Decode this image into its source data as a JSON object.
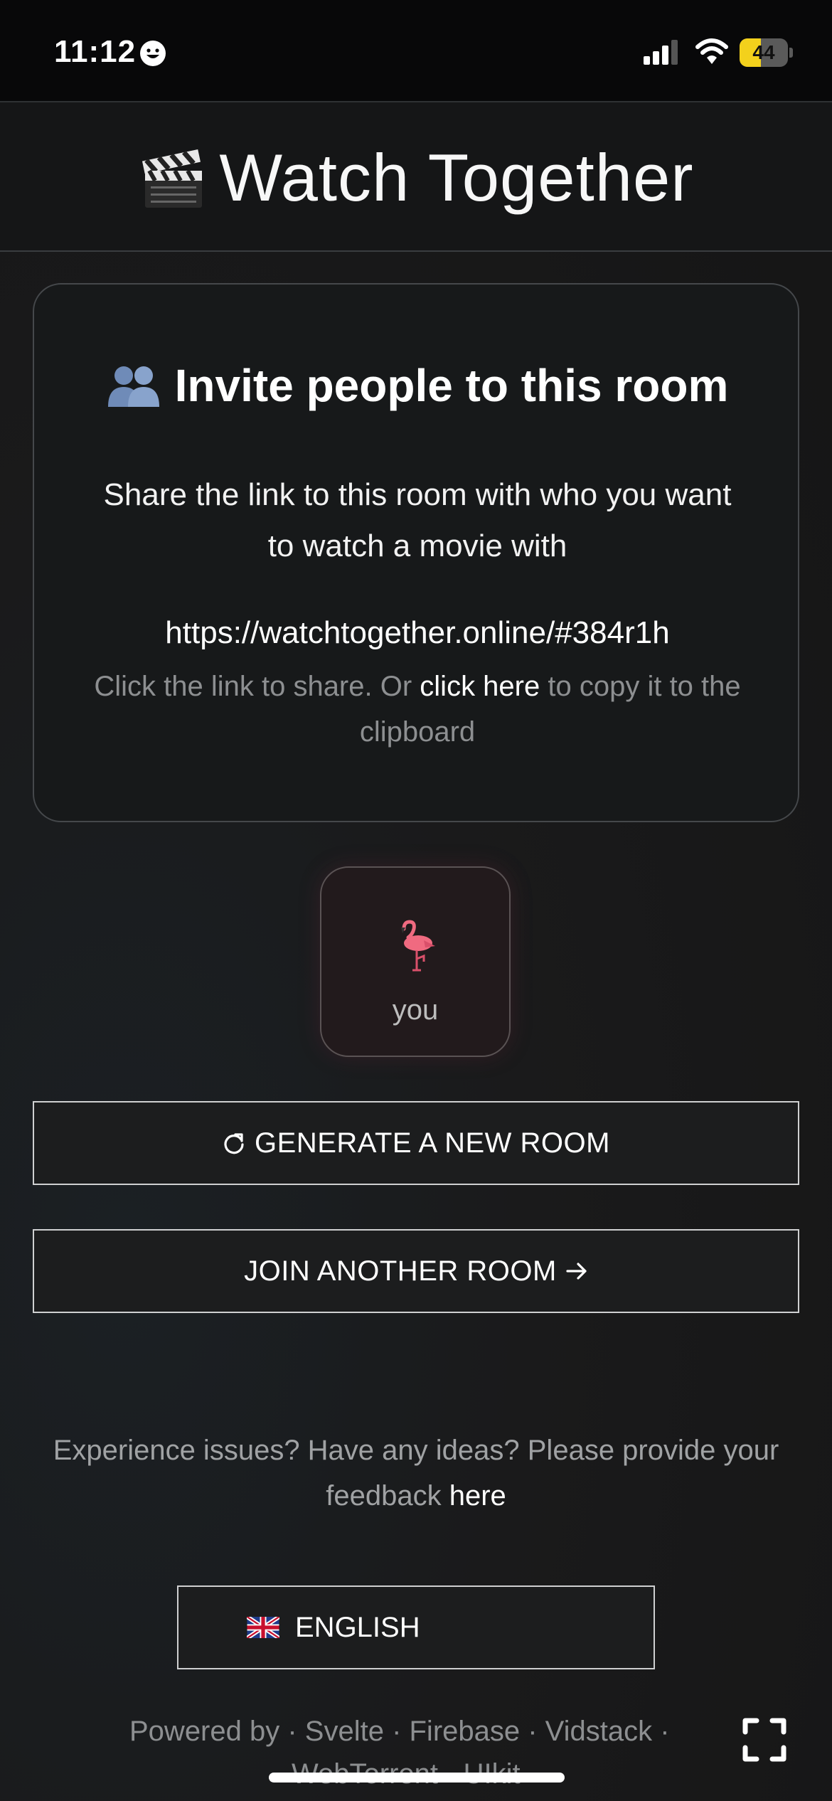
{
  "status_bar": {
    "time": "11:12",
    "battery": "44",
    "battery_level": 0.44
  },
  "header": {
    "title": "Watch Together",
    "icon": "clapper-board-icon"
  },
  "invite": {
    "title": "Invite people to this room",
    "description": "Share the link to this room with who you want to watch a movie with",
    "link": "https://watchtogether.online/#384r1h",
    "hint_prefix": "Click the link to share. Or",
    "hint_link": "click here",
    "hint_suffix": "to copy it to the clipboard"
  },
  "users": [
    {
      "name": "you",
      "avatar": "flamingo-icon"
    }
  ],
  "buttons": {
    "generate": "GENERATE A NEW ROOM",
    "join": "JOIN ANOTHER ROOM"
  },
  "feedback": {
    "prefix": "Experience issues? Have any ideas? Please provide your feedback",
    "link": "here"
  },
  "language": {
    "label": "ENGLISH",
    "flag": "uk-flag-icon"
  },
  "footer": {
    "line1": "Powered by · Svelte · Firebase · Vidstack ·",
    "line2": "WebTorrent · UIkit"
  },
  "colors": {
    "background": "#1a1a1b",
    "battery": "#f3d11c",
    "border": "#cfd0d1"
  }
}
